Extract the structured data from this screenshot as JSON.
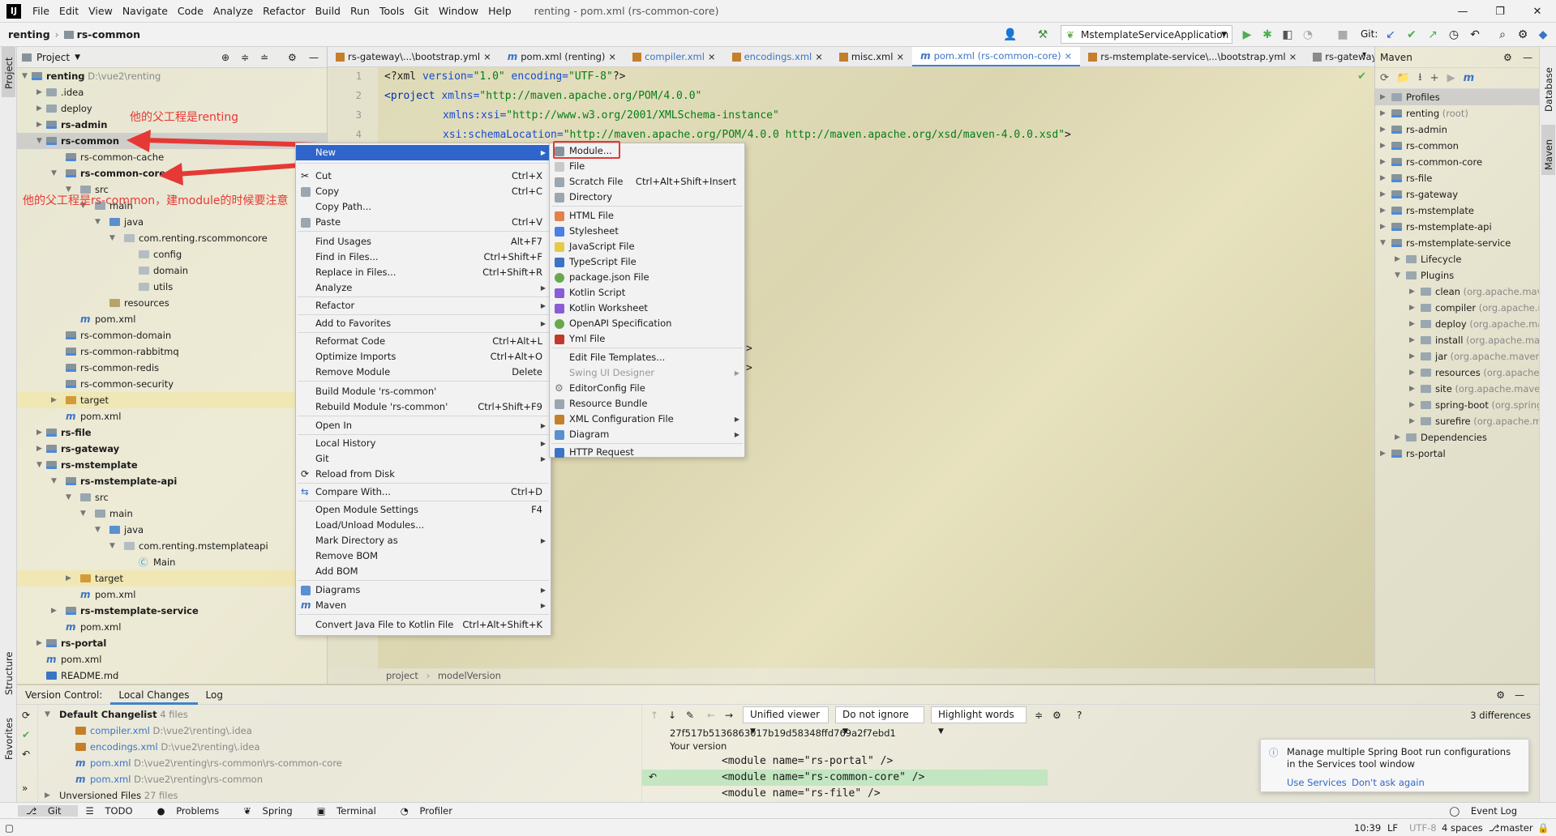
{
  "menubar": {
    "logo": "IJ",
    "items": [
      "File",
      "Edit",
      "View",
      "Navigate",
      "Code",
      "Analyze",
      "Refactor",
      "Build",
      "Run",
      "Tools",
      "Git",
      "Window",
      "Help"
    ],
    "window_title": "renting - pom.xml (rs-common-core)"
  },
  "navbar": {
    "crumb_root": "renting",
    "crumb_module": "rs-common",
    "run_config": "MstemplateServiceApplication",
    "git_label": "Git:"
  },
  "project_panel": {
    "title": "Project",
    "rows": [
      {
        "label": "renting",
        "extra": "D:\\vue2\\renting"
      },
      {
        "label": ".idea"
      },
      {
        "label": "deploy"
      },
      {
        "label": "rs-admin"
      },
      {
        "label": "rs-common"
      },
      {
        "label": "rs-common-cache"
      },
      {
        "label": "rs-common-core"
      },
      {
        "label": "src"
      },
      {
        "label": "main"
      },
      {
        "label": "java"
      },
      {
        "label": "com.renting.rscommoncore"
      },
      {
        "label": "config"
      },
      {
        "label": "domain"
      },
      {
        "label": "utils"
      },
      {
        "label": "resources"
      },
      {
        "label": "pom.xml"
      },
      {
        "label": "rs-common-domain"
      },
      {
        "label": "rs-common-rabbitmq"
      },
      {
        "label": "rs-common-redis"
      },
      {
        "label": "rs-common-security"
      },
      {
        "label": "target"
      },
      {
        "label": "pom.xml"
      },
      {
        "label": "rs-file"
      },
      {
        "label": "rs-gateway"
      },
      {
        "label": "rs-mstemplate"
      },
      {
        "label": "rs-mstemplate-api"
      },
      {
        "label": "src"
      },
      {
        "label": "main"
      },
      {
        "label": "java"
      },
      {
        "label": "com.renting.mstemplateapi"
      },
      {
        "label": "Main"
      },
      {
        "label": "target"
      },
      {
        "label": "pom.xml"
      },
      {
        "label": "rs-mstemplate-service"
      },
      {
        "label": "pom.xml"
      },
      {
        "label": "rs-portal"
      },
      {
        "label": "pom.xml"
      },
      {
        "label": "README.md"
      }
    ]
  },
  "annotations": {
    "a1": "他的父工程是renting",
    "a2": "他的父工程是rs-common，建module的时候要注意"
  },
  "tabs": [
    "rs-gateway\\...\\bootstrap.yml",
    "pom.xml (renting)",
    "compiler.xml",
    "encodings.xml",
    "misc.xml",
    "pom.xml (rs-common-core)",
    "rs-mstemplate-service\\...\\bootstrap.yml",
    "rs-gateway.iml"
  ],
  "editor": {
    "line_numbers": [
      "1",
      "2",
      "3",
      "4"
    ],
    "l1": {
      "decl": "<?xml ",
      "a1": "version=",
      "v1": "\"1.0\"",
      "a2": " encoding=",
      "v2": "\"UTF-8\"",
      "end": "?>"
    },
    "l2": {
      "t": "<project ",
      "a": "xmlns=",
      "v": "\"http://maven.apache.org/POM/4.0.0\""
    },
    "l3": {
      "a": "xmlns:xsi=",
      "v": "\"http://www.w3.org/2001/XMLSchema-instance\""
    },
    "l4": {
      "a": "xsi:schemaLocation=",
      "v": "\"http://maven.apache.org/POM/4.0.0 http://maven.apache.org/xsd/maven-4.0.0.xsd\"",
      "end": ">"
    },
    "partial_a": ">",
    "partial_b": ">"
  },
  "breadcrumb": [
    "project",
    "modelVersion"
  ],
  "context_menu": [
    {
      "label": "New",
      "sub": true,
      "selected": true
    },
    {
      "label": "Cut",
      "key": "Ctrl+X"
    },
    {
      "label": "Copy",
      "key": "Ctrl+C"
    },
    {
      "label": "Copy Path..."
    },
    {
      "label": "Paste",
      "key": "Ctrl+V"
    },
    {
      "label": "Find Usages",
      "key": "Alt+F7"
    },
    {
      "label": "Find in Files...",
      "key": "Ctrl+Shift+F"
    },
    {
      "label": "Replace in Files...",
      "key": "Ctrl+Shift+R"
    },
    {
      "label": "Analyze",
      "sub": true
    },
    {
      "label": "Refactor",
      "sub": true
    },
    {
      "label": "Add to Favorites",
      "sub": true
    },
    {
      "label": "Reformat Code",
      "key": "Ctrl+Alt+L"
    },
    {
      "label": "Optimize Imports",
      "key": "Ctrl+Alt+O"
    },
    {
      "label": "Remove Module",
      "key": "Delete"
    },
    {
      "label": "Build Module 'rs-common'"
    },
    {
      "label": "Rebuild Module 'rs-common'",
      "key": "Ctrl+Shift+F9"
    },
    {
      "label": "Open In",
      "sub": true
    },
    {
      "label": "Local History",
      "sub": true
    },
    {
      "label": "Git",
      "sub": true
    },
    {
      "label": "Reload from Disk"
    },
    {
      "label": "Compare With...",
      "key": "Ctrl+D"
    },
    {
      "label": "Open Module Settings",
      "key": "F4"
    },
    {
      "label": "Load/Unload Modules..."
    },
    {
      "label": "Mark Directory as",
      "sub": true
    },
    {
      "label": "Remove BOM"
    },
    {
      "label": "Add BOM"
    },
    {
      "label": "Diagrams",
      "sub": true
    },
    {
      "label": "Maven",
      "sub": true
    },
    {
      "label": "Convert Java File to Kotlin File",
      "key": "Ctrl+Alt+Shift+K"
    }
  ],
  "new_submenu": [
    {
      "label": "Module..."
    },
    {
      "label": "File"
    },
    {
      "label": "Scratch File",
      "key": "Ctrl+Alt+Shift+Insert"
    },
    {
      "label": "Directory"
    },
    {
      "label": "HTML File"
    },
    {
      "label": "Stylesheet"
    },
    {
      "label": "JavaScript File"
    },
    {
      "label": "TypeScript File"
    },
    {
      "label": "package.json File"
    },
    {
      "label": "Kotlin Script"
    },
    {
      "label": "Kotlin Worksheet"
    },
    {
      "label": "OpenAPI Specification"
    },
    {
      "label": "Yml File"
    },
    {
      "label": "Edit File Templates..."
    },
    {
      "label": "Swing UI Designer",
      "sub": true,
      "disabled": true
    },
    {
      "label": "EditorConfig File"
    },
    {
      "label": "Resource Bundle"
    },
    {
      "label": "XML Configuration File",
      "sub": true
    },
    {
      "label": "Diagram",
      "sub": true
    },
    {
      "label": "HTTP Request"
    }
  ],
  "maven": {
    "title": "Maven",
    "rows": [
      {
        "label": "Profiles"
      },
      {
        "label": "renting",
        "extra": "(root)"
      },
      {
        "label": "rs-admin"
      },
      {
        "label": "rs-common"
      },
      {
        "label": "rs-common-core"
      },
      {
        "label": "rs-file"
      },
      {
        "label": "rs-gateway"
      },
      {
        "label": "rs-mstemplate"
      },
      {
        "label": "rs-mstemplate-api"
      },
      {
        "label": "rs-mstemplate-service"
      },
      {
        "label": "Lifecycle"
      },
      {
        "label": "Plugins"
      },
      {
        "label": "clean",
        "extra": "(org.apache.maven"
      },
      {
        "label": "compiler",
        "extra": "(org.apache.m"
      },
      {
        "label": "deploy",
        "extra": "(org.apache.mav"
      },
      {
        "label": "install",
        "extra": "(org.apache.mave"
      },
      {
        "label": "jar",
        "extra": "(org.apache.maven.p"
      },
      {
        "label": "resources",
        "extra": "(org.apache.m"
      },
      {
        "label": "site",
        "extra": "(org.apache.maven."
      },
      {
        "label": "spring-boot",
        "extra": "(org.spring"
      },
      {
        "label": "surefire",
        "extra": "(org.apache.ma"
      },
      {
        "label": "Dependencies"
      },
      {
        "label": "rs-portal"
      }
    ]
  },
  "vcs": {
    "tabs": [
      "Version Control:",
      "Local Changes",
      "Log"
    ],
    "changelist": {
      "title": "Default Changelist",
      "count": "4 files"
    },
    "files": [
      {
        "name": "compiler.xml",
        "path": "D:\\vue2\\renting\\.idea"
      },
      {
        "name": "encodings.xml",
        "path": "D:\\vue2\\renting\\.idea"
      },
      {
        "name": "pom.xml",
        "path": "D:\\vue2\\renting\\rs-common\\rs-common-core"
      },
      {
        "name": "pom.xml",
        "path": "D:\\vue2\\renting\\rs-common"
      }
    ],
    "unversioned": {
      "title": "Unversioned Files",
      "count": "27 files"
    },
    "diff": {
      "viewer": "Unified viewer",
      "ignore": "Do not ignore",
      "highlight": "Highlight words",
      "count": "3 differences",
      "hash": "27f517b5136863017b19d58348ffd769a2f7ebd1",
      "version_label": "Your version",
      "lines": [
        "<module name=\"rs-portal\" />",
        "<module name=\"rs-common-core\" />",
        "<module name=\"rs-file\" />"
      ]
    }
  },
  "notification": {
    "text": "Manage multiple Spring Boot run configurations in the Services tool window",
    "link1": "Use Services",
    "link2": "Don't ask again"
  },
  "toolwindows": [
    "Git",
    "TODO",
    "Problems",
    "Spring",
    "Terminal",
    "Profiler"
  ],
  "event_log": "Event Log",
  "side_labels": {
    "project": "Project",
    "structure": "Structure",
    "favorites": "Favorites",
    "database": "Database",
    "maven": "Maven"
  },
  "status": {
    "position": "10:39",
    "line_sep": "LF",
    "encoding": "UTF-8",
    "indent": "4 spaces",
    "branch": "master"
  }
}
